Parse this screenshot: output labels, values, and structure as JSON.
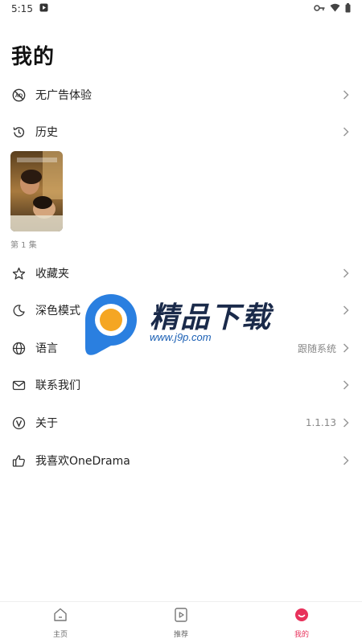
{
  "status_bar": {
    "time": "5:15"
  },
  "header": {
    "title": "我的"
  },
  "menu": [
    {
      "label": "无广告体验",
      "icon": "no-ads-icon"
    },
    {
      "label": "历史",
      "icon": "history-icon"
    },
    {
      "label": "收藏夹",
      "icon": "star-icon"
    },
    {
      "label": "深色模式",
      "icon": "moon-icon"
    },
    {
      "label": "语言",
      "icon": "globe-icon",
      "value": "跟随系统"
    },
    {
      "label": "联系我们",
      "icon": "mail-icon"
    },
    {
      "label": "关于",
      "icon": "about-icon",
      "value": "1.1.13"
    },
    {
      "label": "我喜欢OneDrama",
      "icon": "thumbs-up-icon"
    }
  ],
  "history": {
    "episode": "第 1 集"
  },
  "watermark": {
    "brand": "精品下载",
    "url": "www.j9p.com"
  },
  "tabs": [
    {
      "label": "主页",
      "icon": "home-icon",
      "active": false
    },
    {
      "label": "推荐",
      "icon": "play-icon",
      "active": false
    },
    {
      "label": "我的",
      "icon": "profile-icon",
      "active": true
    }
  ],
  "colors": {
    "accent": "#e8315b",
    "watermark_blue": "#2a7fe0",
    "watermark_orange": "#f5a623"
  }
}
